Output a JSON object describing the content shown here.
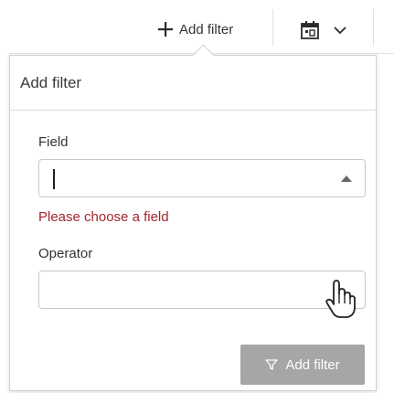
{
  "toolbar": {
    "add_filter_label": "Add filter",
    "icons": [
      "plus-icon",
      "calendar-icon",
      "chevron-down-icon"
    ]
  },
  "popover": {
    "title": "Add filter",
    "field": {
      "label": "Field",
      "value": "",
      "error": "Please choose a field"
    },
    "operator": {
      "label": "Operator",
      "value": ""
    },
    "submit_label": "Add filter",
    "submit_icon": "funnel-icon"
  },
  "colors": {
    "error": "#a4262c",
    "button_disabled": "#a6a6a6",
    "border": "#c8c8c8"
  }
}
